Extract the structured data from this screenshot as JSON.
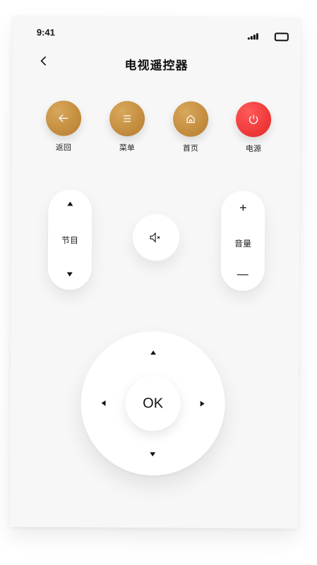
{
  "status_bar": {
    "time": "9:41"
  },
  "header": {
    "title": "电视遥控器"
  },
  "top_buttons": [
    {
      "label": "返回",
      "icon": "arrow-left-icon"
    },
    {
      "label": "菜单",
      "icon": "menu-icon"
    },
    {
      "label": "首页",
      "icon": "home-icon"
    },
    {
      "label": "电源",
      "icon": "power-icon"
    }
  ],
  "channel": {
    "label": "节目",
    "up_icon": "triangle-up-icon",
    "down_icon": "triangle-down-icon"
  },
  "mute": {
    "icon": "mute-icon"
  },
  "volume": {
    "label": "音量",
    "plus": "+",
    "minus": "—"
  },
  "dpad": {
    "ok_label": "OK"
  },
  "colors": {
    "gold": "#c48d3f",
    "power": "#f03a3a",
    "background": "#f7f7f7"
  }
}
